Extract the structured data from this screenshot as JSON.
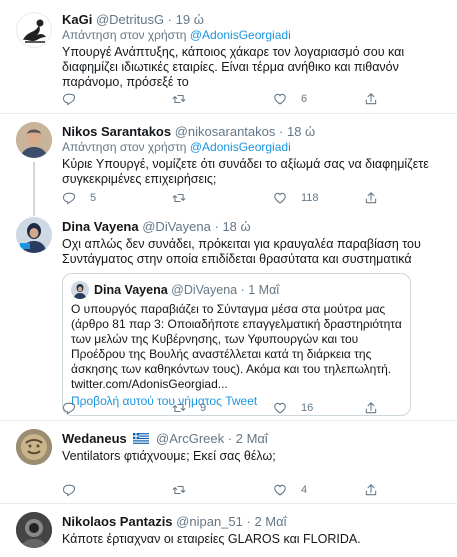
{
  "tweets": [
    {
      "name": "KaGi",
      "handle": "@DetritusG",
      "sep": "·",
      "time": "19 ώ",
      "reply_prefix": "Απάντηση στον χρήστη",
      "reply_mention": "@AdonisGeorgiadi",
      "text": "Υπουργέ Ανάπτυξης, κάποιος χάκαρε τον λογαριασμό σου και διαφημίζει ιδιωτικές εταιρίες. Είναι τέρμα ανήθικο και πιθανόν  παράνομο,  πρόσεξέ το",
      "replies": "",
      "retweets": "",
      "likes": "6"
    },
    {
      "name": "Nikos Sarantakos",
      "handle": "@nikosarantakos",
      "sep": "·",
      "time": "18 ώ",
      "reply_prefix": "Απάντηση στον χρήστη",
      "reply_mention": "@AdonisGeorgiadi",
      "text": "Κύριε Υπουργέ,  νομίζετε ότι συνάδει το αξίωμά σας να διαφημίζετε συγκεκριμένες επιχειρήσεις;",
      "replies": "5",
      "retweets": "",
      "likes": "118"
    },
    {
      "name": "Dina Vayena",
      "handle": "@DiVayena",
      "sep": "·",
      "time": "18 ώ",
      "text": "Οχι απλώς δεν συνάδει, πρόκειται για κραυγαλέα παραβίαση του Συντάγματος στην οποία επιδίδεται θρασύτατα και συστηματικά",
      "quote": {
        "name": "Dina Vayena",
        "handle": "@DiVayena",
        "sep": "·",
        "time": "1 Μαΐ",
        "text": "Ο υπουργός παραβιάζει το Σύνταγμα μέσα στα μούτρα μας (άρθρο 81 παρ 3: Οποιαδήποτε επαγγελματική δραστηριότητα των μελών της Κυβέρνησης, των Υφυπουργών και του Προέδρου της Βουλής αναστέλλεται κατά τη διάρκεια της άσκησης των καθηκόντων τους). Ακόμα και του τηλεπωλητή. twitter.com/AdonisGeorgiad...",
        "link": "Προβολή αυτού του νήματος Tweet"
      },
      "replies": "",
      "retweets": "9",
      "likes": "16"
    },
    {
      "name": "Wedaneus",
      "handle": "@ArcGreek",
      "sep": "·",
      "time": "2 Μαΐ",
      "text": "Ventilators φτιάχνουμε; Εκεί σας θέλω;",
      "replies": "",
      "retweets": "",
      "likes": "4"
    },
    {
      "name": "Nikolaos Pantazis",
      "handle": "@nipan_51",
      "sep": "·",
      "time": "2 Μαΐ",
      "text": "Κάποτε έρτιαχναν οι εταιρείες GLAROS και FLORIDA."
    }
  ],
  "colors": {
    "accent": "#1b95e0",
    "muted": "#657786",
    "like": "#657786"
  },
  "icons": [
    "reply-icon",
    "retweet-icon",
    "like-icon",
    "share-icon",
    "greek-flag-icon"
  ]
}
